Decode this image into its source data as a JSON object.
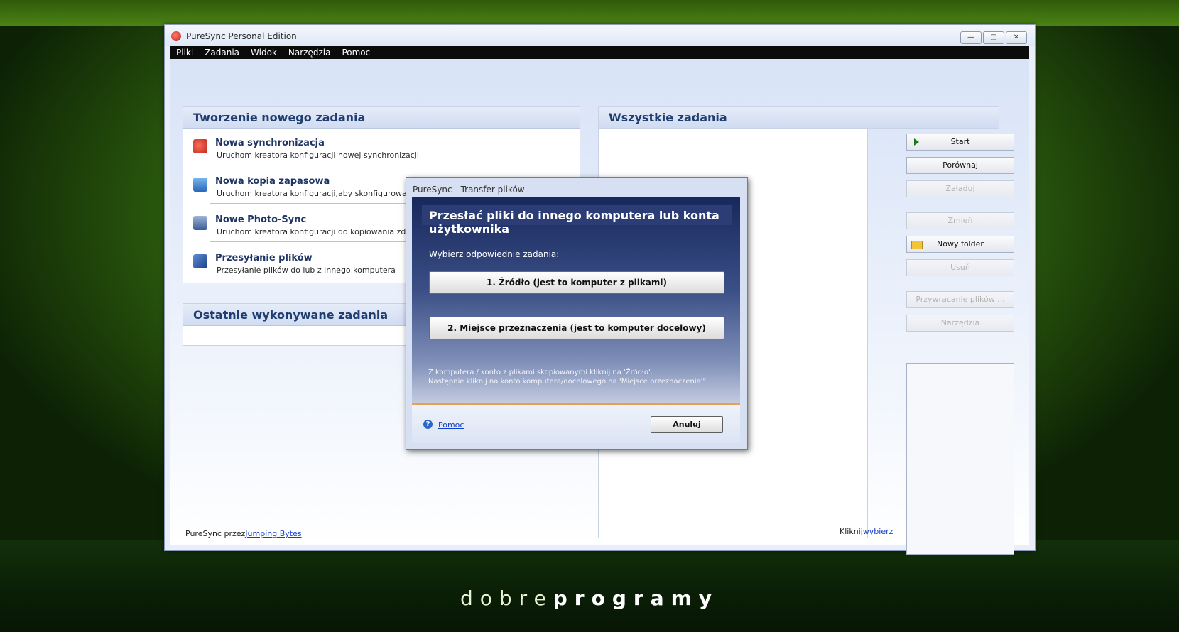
{
  "window": {
    "title": "PureSync Personal Edition"
  },
  "menu": [
    "Pliki",
    "Zadania",
    "Widok",
    "Narzędzia",
    "Pomoc"
  ],
  "new_task": {
    "title": "Tworzenie nowego zadania",
    "items": [
      {
        "title": "Nowa synchronizacja",
        "desc": "Uruchom kreatora konfiguracji nowej synchronizacji"
      },
      {
        "title": "Nowa kopia zapasowa",
        "desc": "Uruchom kreatora konfiguracji,aby skonfigurować nową kopię zapasową"
      },
      {
        "title": "Nowe Photo-Sync",
        "desc": "Uruchom kreatora konfiguracji do kopiowania zdjęć z cy"
      },
      {
        "title": "Przesyłanie plików",
        "desc": "Przesyłanie plików do lub z innego komputera"
      }
    ]
  },
  "recent": {
    "title": "Ostatnie wykonywane zadania"
  },
  "footer": {
    "prefix": "PureSync przez",
    "link": "Jumping Bytes"
  },
  "all_tasks": {
    "title": "Wszystkie zadania",
    "hint_prefix": "Kliknij",
    "hint_link": "wybierz"
  },
  "buttons": {
    "start": "Start",
    "compare": "Porównaj",
    "load": "Załaduj",
    "change": "Zmień",
    "new_folder": "Nowy folder",
    "delete": "Usuń",
    "restore": "Przywracanie plików ...",
    "tools": "Narzędzia"
  },
  "dialog": {
    "title": "PureSync - Transfer plików",
    "heading": "Przesłać pliki do innego komputera lub konta użytkownika",
    "subtitle": "Wybierz odpowiednie zadania:",
    "option1": "1. Źródło  (jest to komputer z plikami)",
    "option2": "2. Miejsce przeznaczenia (jest to komputer docelowy)",
    "note_line1": "Z komputera / konto z plikami skopiowanymi kliknij na 'Źródło'.",
    "note_line2": "Następnie kliknij na konto komputera/docelowego na 'Miejsce przeznaczenia'\"",
    "help": "Pomoc",
    "cancel": "Anuluj"
  },
  "brand": {
    "light": "dobre",
    "bold": "programy"
  },
  "colors": {
    "panel_title": "#1f3e6f",
    "dialog_bg": "#17285c",
    "link": "#1140c8"
  }
}
